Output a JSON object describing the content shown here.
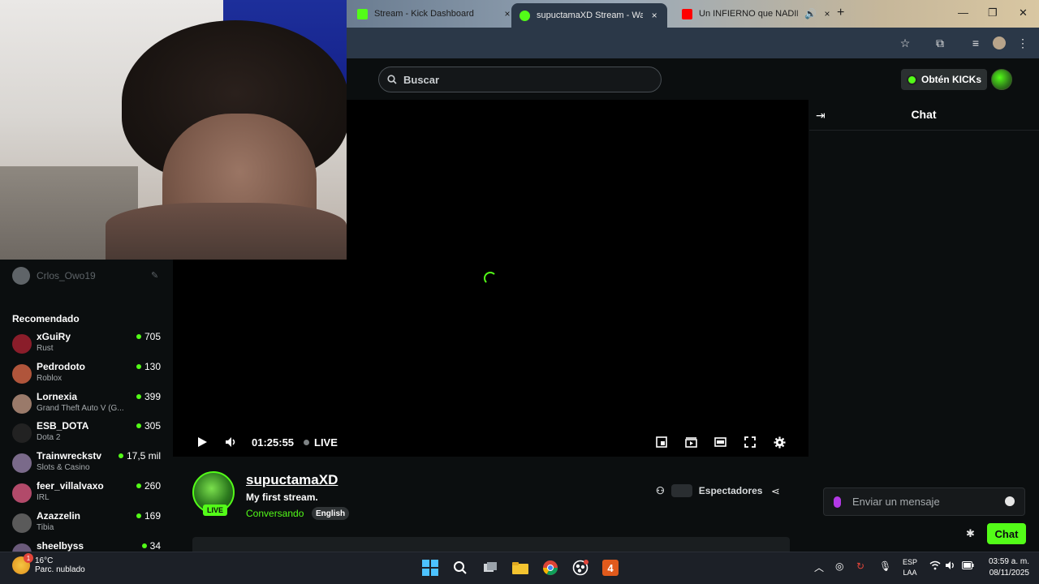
{
  "browser": {
    "tabs": [
      {
        "title": "Stream - Kick Dashboard",
        "favicon_color": "#53fc18",
        "active": false
      },
      {
        "title": "supuctamaXD Stream - Watch",
        "favicon_color": "#53fc18",
        "active": true
      },
      {
        "title": "Un INFIERNO que NADIE C",
        "favicon_color": "#ff0000",
        "active": false
      }
    ],
    "close_glyph": "×",
    "new_tab_glyph": "+",
    "audio_glyph": "🔊"
  },
  "header": {
    "search_placeholder": "Buscar",
    "kicks_label": "Obtén KICKs"
  },
  "player": {
    "time": "01:25:55",
    "live_label": "LIVE"
  },
  "chat": {
    "title": "Chat",
    "message_placeholder": "Enviar un mensaje",
    "send_label": "Chat"
  },
  "stream": {
    "streamer": "supuctamaXD",
    "title": "My first stream.",
    "category": "Conversando",
    "language": "English",
    "live_badge": "LIVE",
    "viewers_label": "Espectadores"
  },
  "sidebar": {
    "followed_user": "Crlos_Owo19",
    "recommended_heading": "Recomendado",
    "recommended": [
      {
        "name": "xGuiRy",
        "category": "Rust",
        "viewers": "705",
        "avatar_color": "#8a1d2a"
      },
      {
        "name": "Pedrodoto",
        "category": "Roblox",
        "viewers": "130",
        "avatar_color": "#b0553b"
      },
      {
        "name": "Lornexia",
        "category": "Grand Theft Auto V (G...",
        "viewers": "399",
        "avatar_color": "#9a7a6a"
      },
      {
        "name": "ESB_DOTA",
        "category": "Dota 2",
        "viewers": "305",
        "avatar_color": "#222222"
      },
      {
        "name": "Trainwreckstv",
        "category": "Slots & Casino",
        "viewers": "17,5 mil",
        "avatar_color": "#7a6a8a"
      },
      {
        "name": "feer_villalvaxo",
        "category": "IRL",
        "viewers": "260",
        "avatar_color": "#b24a6a"
      },
      {
        "name": "Azazzelin",
        "category": "Tibia",
        "viewers": "169",
        "avatar_color": "#5a5a5a"
      },
      {
        "name": "sheelbyss",
        "category": "",
        "viewers": "34",
        "avatar_color": "#6a5a7a"
      }
    ]
  },
  "taskbar": {
    "temperature": "16°C",
    "weather": "Parc. nublado",
    "weather_badge": "1",
    "lang_line1": "ESP",
    "lang_line2": "LAA",
    "time": "03:59 a. m.",
    "date": "08/11/2025"
  },
  "colors": {
    "accent": "#53fc18",
    "background": "#0b0e0f",
    "browser_chrome": "#2b3848"
  }
}
